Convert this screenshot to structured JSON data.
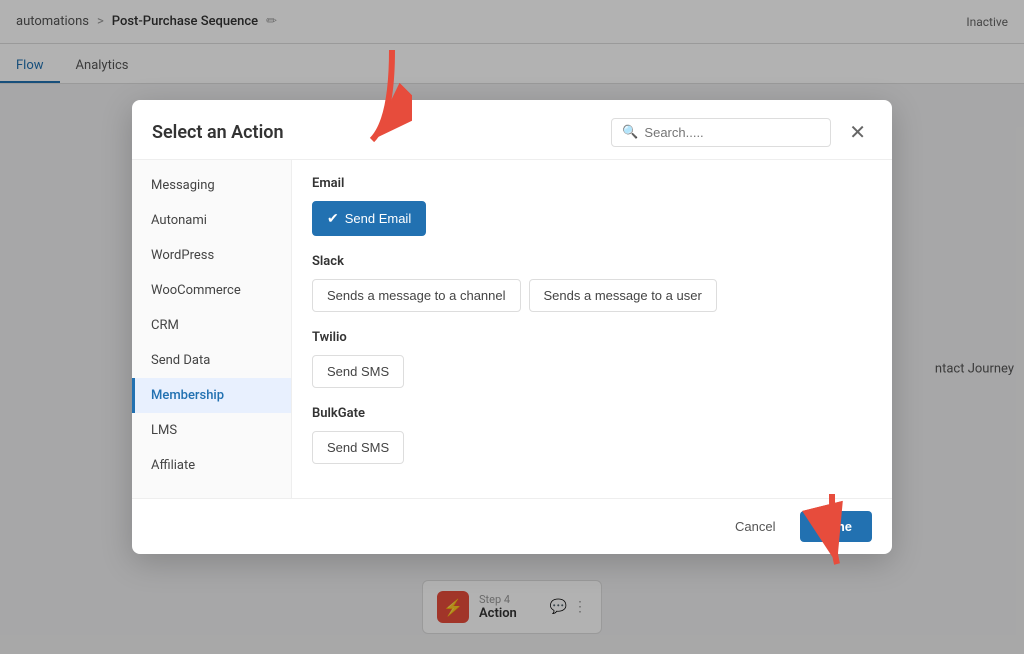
{
  "topbar": {
    "breadcrumb_parent": "automations",
    "breadcrumb_sep": ">",
    "breadcrumb_current": "Post-Purchase Sequence",
    "edit_icon": "✏",
    "status_label": "Inactive"
  },
  "tabs": [
    {
      "label": "Flow",
      "active": true
    },
    {
      "label": "Analytics",
      "active": false
    }
  ],
  "right_label": "ntact Journey",
  "step": {
    "number": "Step 4",
    "label": "Action"
  },
  "modal": {
    "title": "Select an Action",
    "search_placeholder": "Search.....",
    "close_icon": "✕",
    "sidebar_items": [
      {
        "label": "Messaging",
        "active": false
      },
      {
        "label": "Autonami",
        "active": false
      },
      {
        "label": "WordPress",
        "active": false
      },
      {
        "label": "WooCommerce",
        "active": false
      },
      {
        "label": "CRM",
        "active": false
      },
      {
        "label": "Send Data",
        "active": false
      },
      {
        "label": "Membership",
        "active": true
      },
      {
        "label": "LMS",
        "active": false
      },
      {
        "label": "Affiliate",
        "active": false
      }
    ],
    "sections": [
      {
        "title": "Email",
        "actions": [
          {
            "label": "Send Email",
            "selected": true,
            "check": "✔"
          }
        ]
      },
      {
        "title": "Slack",
        "actions": [
          {
            "label": "Sends a message to a channel",
            "selected": false
          },
          {
            "label": "Sends a message to a user",
            "selected": false
          }
        ]
      },
      {
        "title": "Twilio",
        "actions": [
          {
            "label": "Send SMS",
            "selected": false
          }
        ]
      },
      {
        "title": "BulkGate",
        "actions": [
          {
            "label": "Send SMS",
            "selected": false
          }
        ]
      }
    ],
    "footer": {
      "cancel_label": "Cancel",
      "done_label": "Done"
    }
  }
}
